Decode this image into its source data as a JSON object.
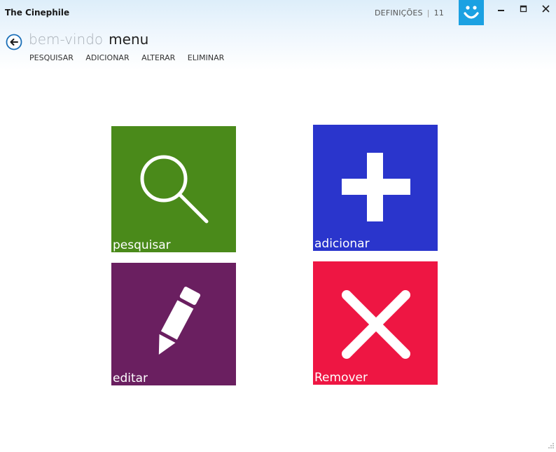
{
  "window": {
    "title": "The Cinephile",
    "settings_label": "DEFINIÇÕES",
    "settings_separator": "|",
    "settings_value": "11"
  },
  "header": {
    "breadcrumb_previous": "bem-vindo",
    "page_title": "menu"
  },
  "menu": {
    "search": "PESQUISAR",
    "add": "ADICIONAR",
    "alter": "ALTERAR",
    "delete": "ELIMINAR"
  },
  "tiles": {
    "search": {
      "label": "pesquisar",
      "color": "#4a8a1a",
      "icon": "search-icon"
    },
    "add": {
      "label": "adicionar",
      "color": "#2a35cc",
      "icon": "plus-icon"
    },
    "edit": {
      "label": "editar",
      "color": "#6a1f60",
      "icon": "pencil-icon"
    },
    "remove": {
      "label": "Remover",
      "color": "#ee1643",
      "icon": "close-icon"
    }
  },
  "colors": {
    "accent": "#1ba1e2"
  }
}
